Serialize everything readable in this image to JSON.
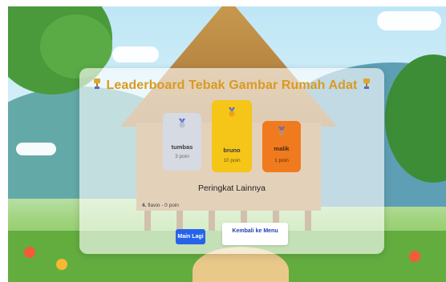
{
  "leaderboard": {
    "title": "Leaderboard Tebak Gambar Rumah Adat",
    "icons": {
      "title_left": "trophy-icon",
      "title_right": "trophy-icon",
      "medal": "medal-icon"
    },
    "podium": [
      {
        "rank": 2,
        "name": "tumbas",
        "points": "3 poin",
        "color": "#d6dae2"
      },
      {
        "rank": 1,
        "name": "bruno",
        "points": "10 poin",
        "color": "#f5c518"
      },
      {
        "rank": 3,
        "name": "malik",
        "points": "1 poin",
        "color": "#f07a1e"
      }
    ],
    "others_title": "Peringkat Lainnya",
    "others": [
      {
        "number": "4.",
        "text": "flavio - 0 poin"
      }
    ]
  },
  "buttons": {
    "play_again": "Main Lagi",
    "back_to_menu": "Kembali ke Menu"
  },
  "colors": {
    "title": "#d99a22",
    "primary_button": "#2563eb",
    "secondary_button_text": "#1e40af"
  }
}
